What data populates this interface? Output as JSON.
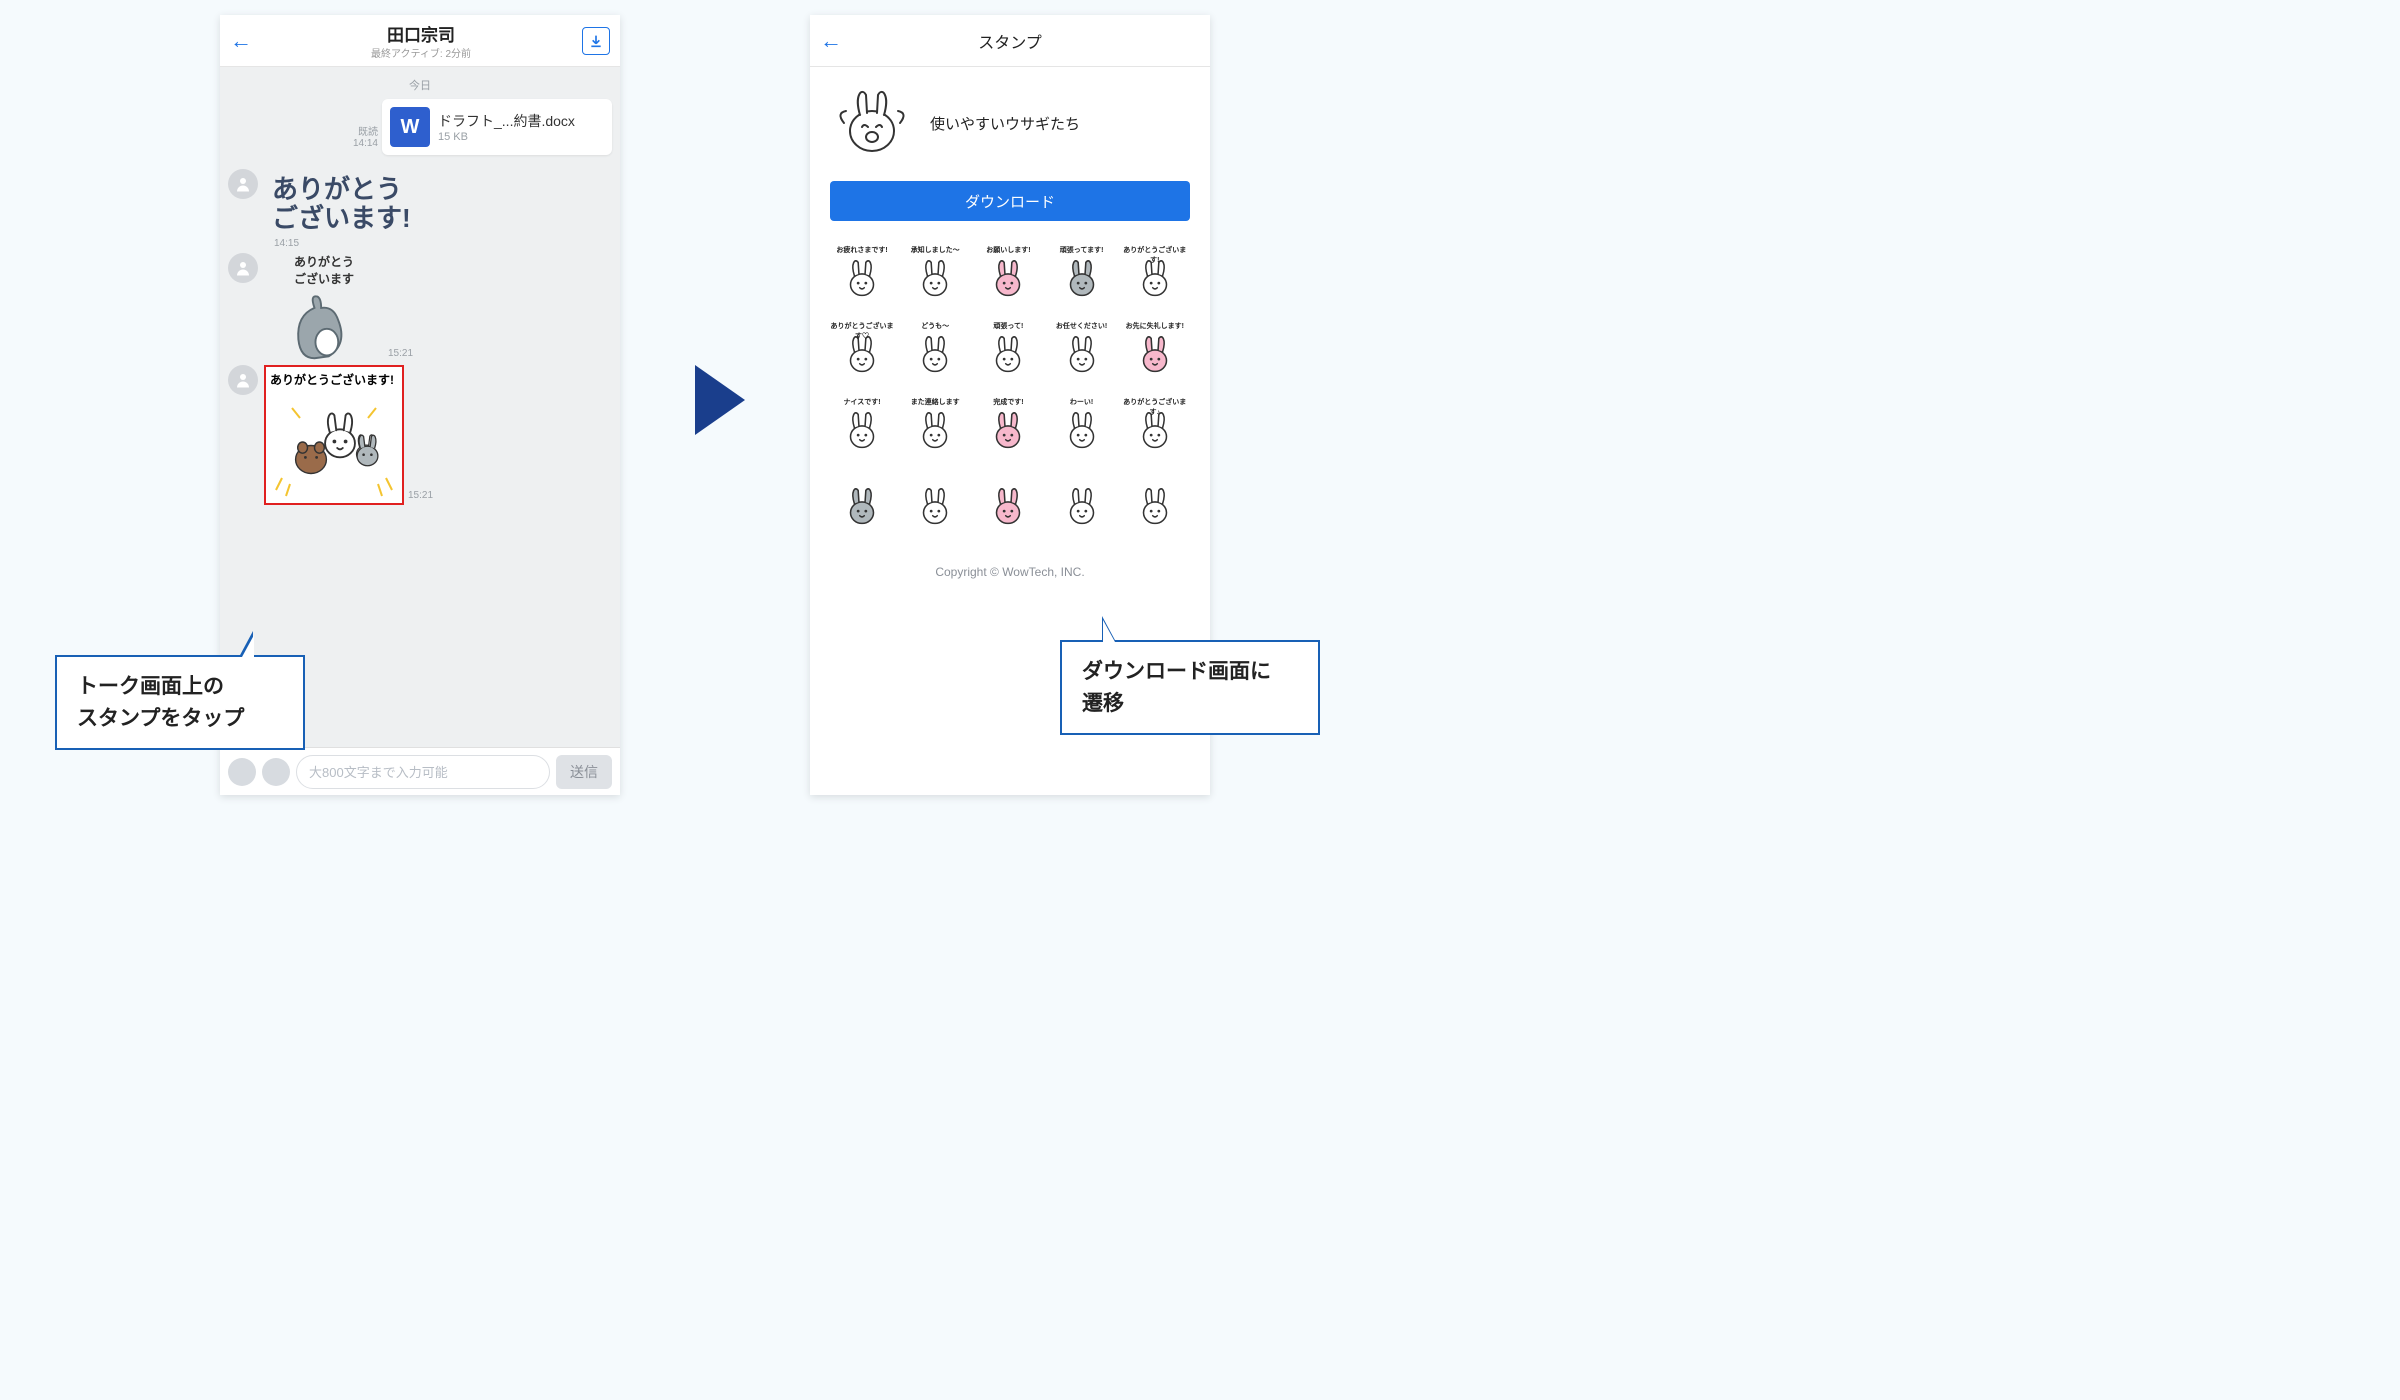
{
  "left": {
    "header": {
      "title": "田口宗司",
      "subtitle": "最終アクティブ: 2分前"
    },
    "dateSeparator": "今日",
    "fileMsg": {
      "readLabel": "既読",
      "time": "14:14",
      "name": "ドラフト_...約書.docx",
      "size": "15 KB",
      "iconLetter": "W"
    },
    "thanks": {
      "line1": "ありがとう",
      "line2": "ございます!",
      "time": "14:15"
    },
    "catSticker": {
      "label": "ありがとう\nございます",
      "time": "15:21"
    },
    "rabbitSticker": {
      "label": "ありがとうございます!",
      "time": "15:21"
    },
    "input": {
      "placeholder": "大800文字まで入力可能",
      "sendLabel": "送信"
    }
  },
  "right": {
    "headerTitle": "スタンプ",
    "packName": "使いやすいウサギたち",
    "downloadLabel": "ダウンロード",
    "grid": [
      "お疲れさまです!",
      "承知しました〜",
      "お願いします!",
      "頑張ってます!",
      "ありがとうございます!",
      "ありがとうございます♡",
      "どうも〜",
      "頑張って!",
      "お任せください!",
      "お先に失礼します!",
      "ナイスです!",
      "また連絡します",
      "完成です!",
      "わーい!",
      "ありがとうございます♪",
      "",
      "",
      "",
      "",
      ""
    ],
    "copyright": "Copyright © WowTech, INC."
  },
  "callouts": {
    "c1_l1": "トーク画面上の",
    "c1_l2": "スタンプをタップ",
    "c2_l1": "ダウンロード画面に",
    "c2_l2": "遷移"
  }
}
